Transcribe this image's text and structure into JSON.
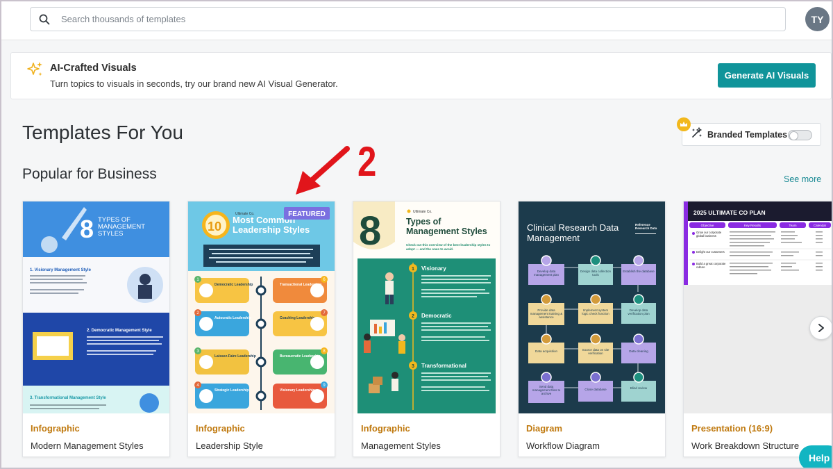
{
  "search": {
    "placeholder": "Search thousands of templates"
  },
  "user": {
    "initials": "TY"
  },
  "ai_banner": {
    "title": "AI-Crafted Visuals",
    "subtitle": "Turn topics to visuals in seconds, try our brand new AI Visual Generator.",
    "button": "Generate AI Visuals"
  },
  "section": {
    "heading": "Templates For You",
    "subheading": "Popular for Business",
    "see_more": "See more",
    "branded_label": "Branded Templates"
  },
  "annotation": {
    "number": "2"
  },
  "cards": [
    {
      "category": "Infographic",
      "name": "Modern Management Styles",
      "thumb": {
        "big_number": "8",
        "title": "TYPES OF MANAGEMENT STYLES",
        "items": [
          "1. Visionary Management Style",
          "2. Democratic Management Style",
          "3. Transformational Management Style"
        ]
      }
    },
    {
      "category": "Infographic",
      "name": "Leadership Style",
      "thumb": {
        "badge": "FEATURED",
        "brand": "Ultimate Co.",
        "big_number": "10",
        "title": "Most Common Leadership Styles",
        "left": [
          "Democratic Leadership",
          "Autocratic Leadership",
          "Laissez-Faire Leadership",
          "Strategic Leadership"
        ],
        "right": [
          "Transactional Leadership",
          "Coaching Leadership",
          "Bureaucratic Leadership",
          "Visionary Leadership"
        ],
        "nums_left": [
          "1",
          "2",
          "3",
          "4"
        ],
        "nums_right": [
          "6",
          "7",
          "8",
          "9"
        ]
      }
    },
    {
      "category": "Infographic",
      "name": "Management Styles",
      "thumb": {
        "brand": "Ultimate Co.",
        "big_number": "8",
        "title": "Types of Management Styles",
        "subtitle": "Check out this overview of the best leadership styles to adopt — and the ones to avoid.",
        "items": [
          {
            "num": "1",
            "label": "Visionary"
          },
          {
            "num": "2",
            "label": "Democratic"
          },
          {
            "num": "3",
            "label": "Transformational"
          }
        ]
      }
    },
    {
      "category": "Diagram",
      "name": "Workflow Diagram",
      "thumb": {
        "title": "Clinical Research Data Management",
        "ref": "Reference Research Data",
        "nodes": [
          "Develop data management plan",
          "Design data collection tools",
          "Establish the database",
          "Provide data management training & assistance",
          "Implement system logic check function",
          "Develop data verification plan",
          "Data acquisition",
          "Source data on site verification",
          "Data cleaning",
          "Send data management files to archive",
          "Close database",
          "Blind review"
        ]
      }
    },
    {
      "category": "Presentation (16:9)",
      "name": "Work Breakdown Structure",
      "thumb": {
        "title": "2025 ULTIMATE CO PLAN",
        "headers": [
          "Objective",
          "Key Results",
          "Team",
          "Calendar"
        ],
        "rows": [
          "Grow our corporate global business",
          "Delight our customers",
          "Build a great corporate culture"
        ]
      }
    }
  ],
  "help": {
    "label": "Help"
  }
}
